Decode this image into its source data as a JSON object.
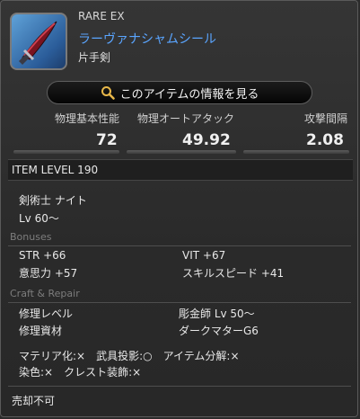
{
  "item": {
    "rarity": "RARE EX",
    "name": "ラーヴァナシャムシール",
    "type": "片手剣"
  },
  "info_button": {
    "label": "このアイテムの情報を見る"
  },
  "stats": [
    {
      "label": "物理基本性能",
      "value": "72"
    },
    {
      "label": "物理オートアタック",
      "value": "49.92"
    },
    {
      "label": "攻撃間隔",
      "value": "2.08"
    }
  ],
  "item_level": "ITEM LEVEL 190",
  "classes": "剣術士 ナイト",
  "level_req": "Lv 60～",
  "bonuses": {
    "header": "Bonuses",
    "items": [
      "STR +66",
      "VIT +67",
      "意思力 +57",
      "スキルスピード +41"
    ]
  },
  "craft": {
    "header": "Craft & Repair",
    "repair_level_label": "修理レベル",
    "repair_level_value": "彫金師 Lv 50～",
    "repair_material_label": "修理資材",
    "repair_material_value": "ダークマターG6",
    "line1": "マテリア化:×　武具投影:○　アイテム分解:×",
    "line2": "染色:×　クレスト装飾:×"
  },
  "sell": "売却不可",
  "colors": {
    "name": "#5aa5ff",
    "section": "#7d7d7d",
    "background": "#2b2b2b"
  }
}
